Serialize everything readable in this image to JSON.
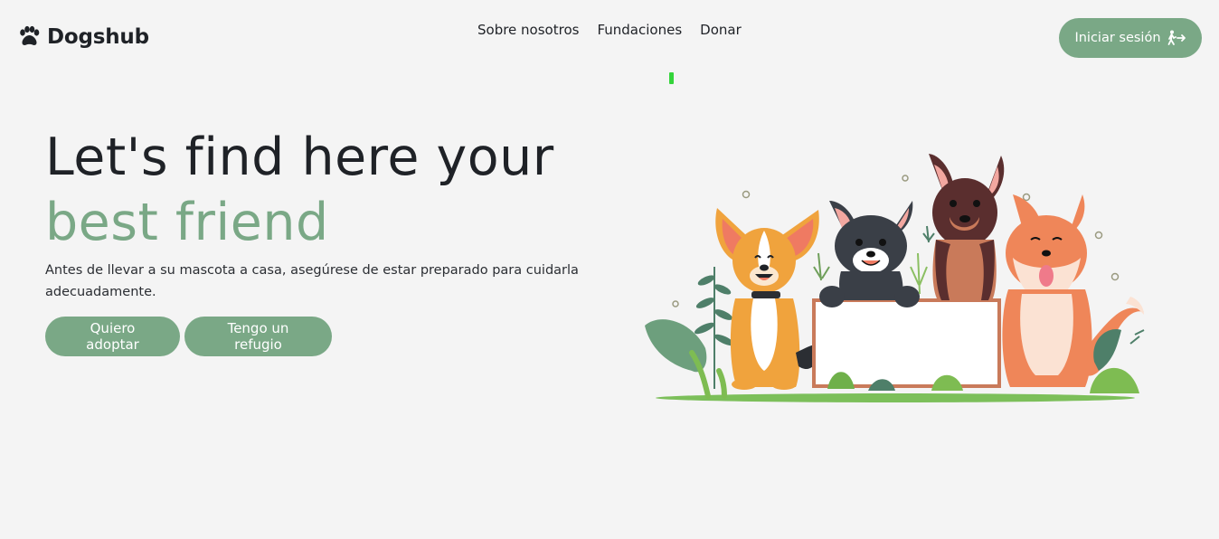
{
  "brand": {
    "name": "Dogshub",
    "icon": "paw-icon"
  },
  "nav": {
    "items": [
      "Sobre nosotros",
      "Fundaciones",
      "Donar"
    ]
  },
  "header": {
    "login_label": "Iniciar sesión",
    "login_icon": "walking-exit-icon"
  },
  "hero": {
    "title_line1": "Let's find here your",
    "title_line2": "best friend",
    "subtitle": "Antes de llevar a su mascota a casa, asegúrese de estar preparado para cuidarla adecuadamente.",
    "cta_adopt": "Quiero adoptar",
    "cta_shelter": "Tengo un refugio"
  },
  "colors": {
    "accent": "#7aa886",
    "background": "#f4f4f4",
    "text": "#1f2227",
    "indicator": "#34d43a"
  }
}
